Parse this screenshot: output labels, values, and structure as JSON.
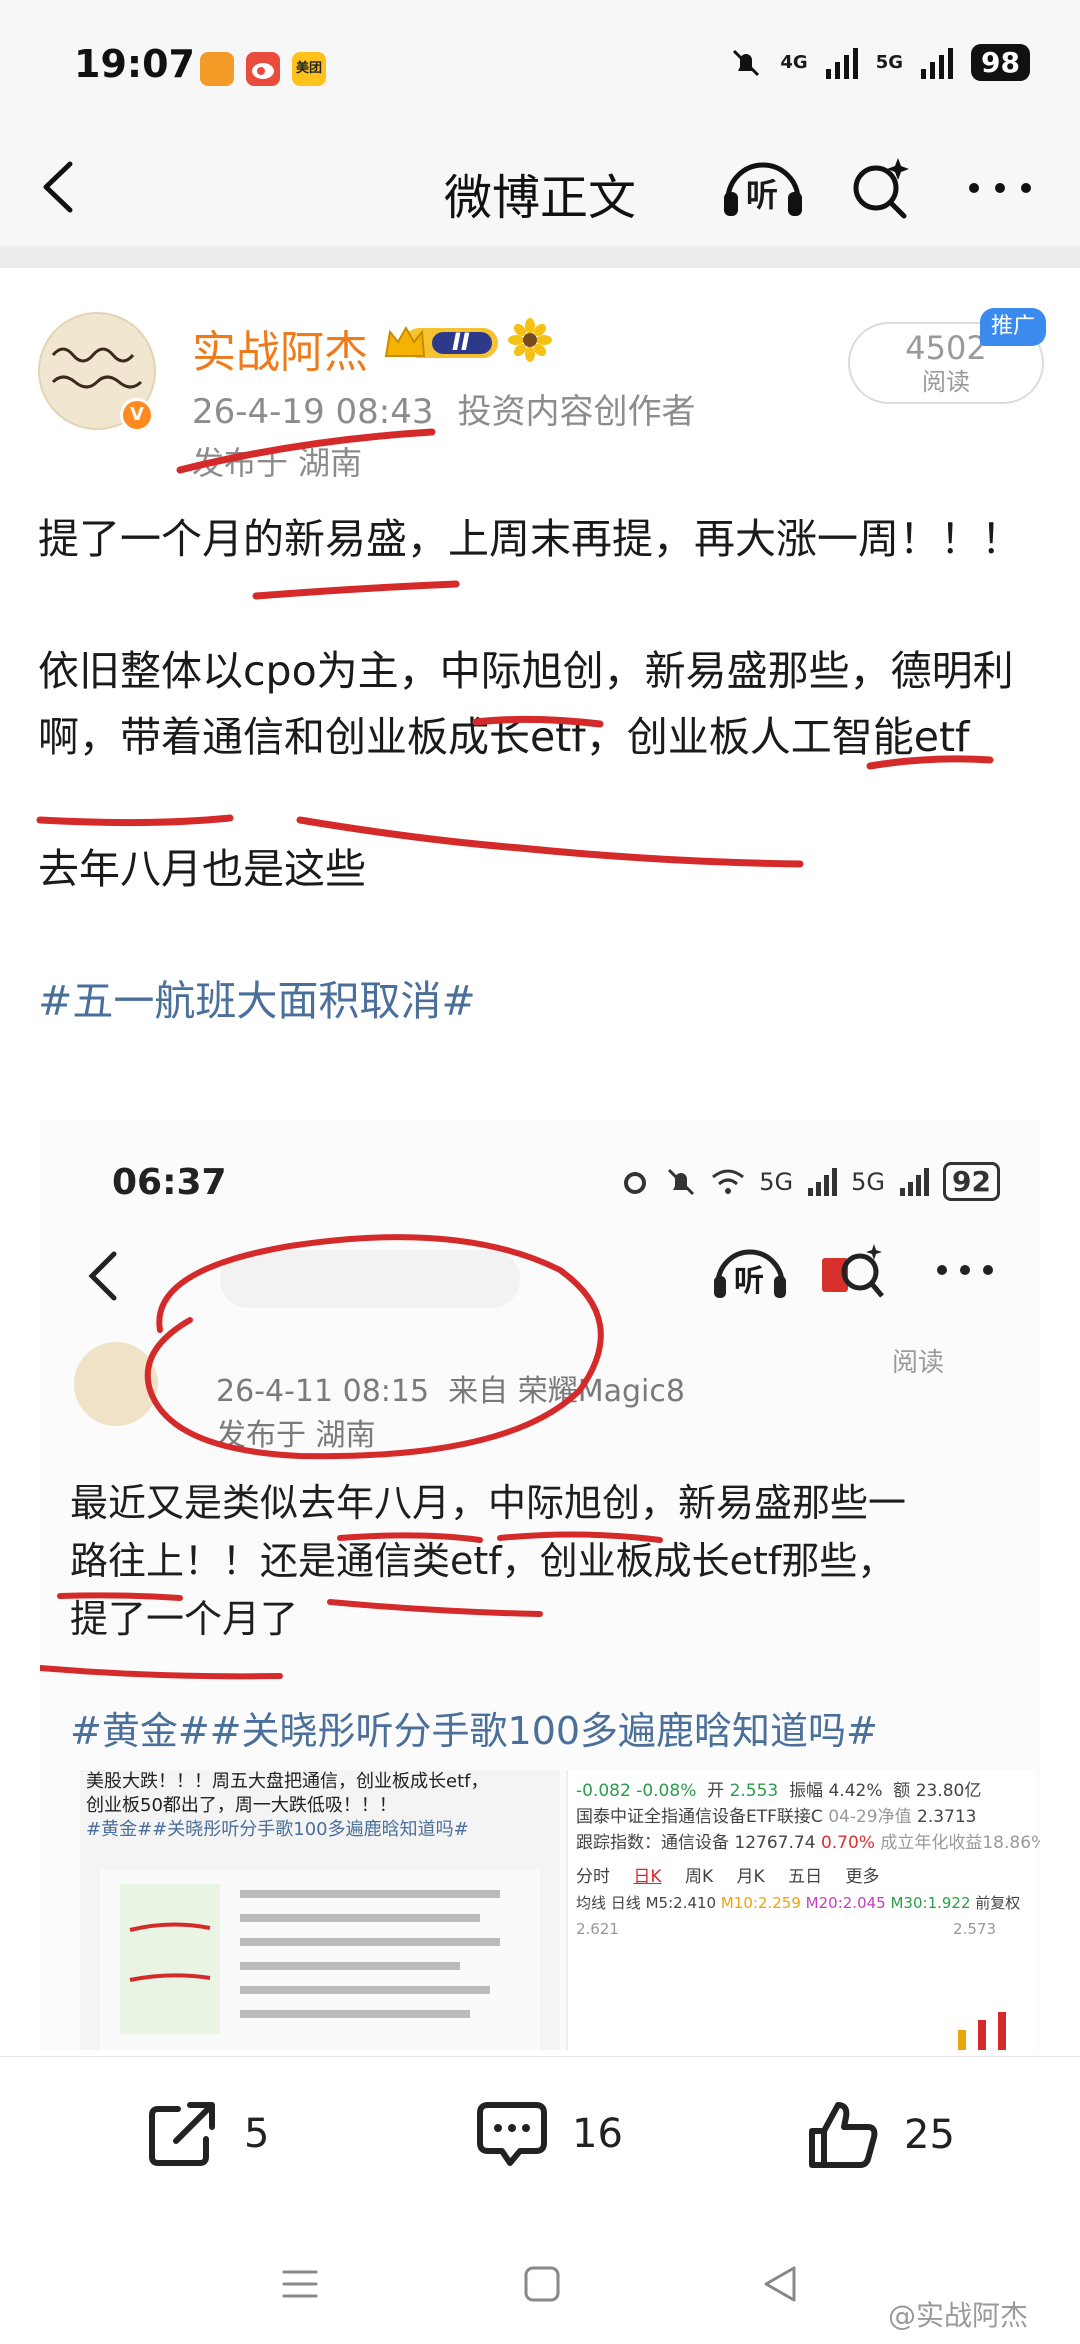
{
  "status_bar": {
    "time": "19:07",
    "app_icons": [
      "notification-app-icon",
      "weibo-app-icon",
      "meituan-app-icon"
    ],
    "app_icon_labels": [
      "",
      "",
      "美团"
    ],
    "network1": "4G",
    "network2": "5G",
    "battery": "98"
  },
  "header": {
    "title": "微博正文",
    "listen_label": "听"
  },
  "post": {
    "author": "实战阿杰",
    "level_badge": "II",
    "timestamp": "26-4-19 08:43",
    "role": "投资内容创作者",
    "location": "发布于 湖南",
    "read_count": "4502",
    "read_label": "阅读",
    "promo_tag": "推广",
    "paragraphs": [
      "提了一个月的新易盛，上周末再提，再大涨一周！！！",
      "依旧整体以cpo为主，中际旭创，新易盛那些，德明利啊，带着通信和创业板成长etf，创业板人工智能etf",
      "去年八月也是这些"
    ],
    "hashtag": "#五一航班大面积取消#"
  },
  "embed": {
    "time": "06:37",
    "network1": "5G",
    "network2": "5G",
    "battery": "92",
    "listen_label": "听",
    "timestamp": "26-4-11 08:15",
    "source": "来自 荣耀Magic8",
    "location": "发布于 湖南",
    "read_label": "阅读",
    "body_lines": [
      "最近又是类似去年八月，中际旭创，新易盛那些一",
      "路往上！！还是通信类etf，创业板成长etf那些，",
      "提了一个月了"
    ],
    "hashtags": "#黄金##关晓彤听分手歌100多遍鹿晗知道吗#",
    "thumb_left_lines": [
      "美股大跌！！！周五大盘把通信，创业板成长etf，",
      "创业板50都出了，周一大跌低吸！！！",
      "#黄金##关晓彤听分手歌100多遍鹿晗知道吗#"
    ],
    "thumb_right": {
      "change": "-0.082  -0.08%",
      "open_label": "开",
      "open": "2.553",
      "amp_label": "振幅",
      "amp": "4.42%",
      "vol_label": "额",
      "vol": "23.80亿",
      "fund_name": "国泰中证全指通信设备ETF联接C",
      "fund_date": "04-29净值",
      "fund_nav": "2.3713",
      "index_label": "跟踪指数：通信设备",
      "index_value": "12767.74",
      "index_change": "0.70%",
      "index_note": "成立年化收益18.86%",
      "tabs": [
        "分时",
        "日K",
        "周K",
        "月K",
        "五日",
        "更多"
      ],
      "ma_label": "均线",
      "ma_line": "日线",
      "ma5": "M5:2.410",
      "ma10": "M10:2.259",
      "ma20": "M20:2.045",
      "ma30": "M30:1.922",
      "adjust": "前复权",
      "price_low": "2.621",
      "price_high": "2.573"
    }
  },
  "actions": {
    "share_count": "5",
    "comment_count": "16",
    "like_count": "25"
  },
  "watermark": "@实战阿杰",
  "colors": {
    "author": "#ee7a1a",
    "hashtag": "#4a6f9a",
    "promo": "#3b8bee",
    "annotation_red": "#d42a2a"
  }
}
